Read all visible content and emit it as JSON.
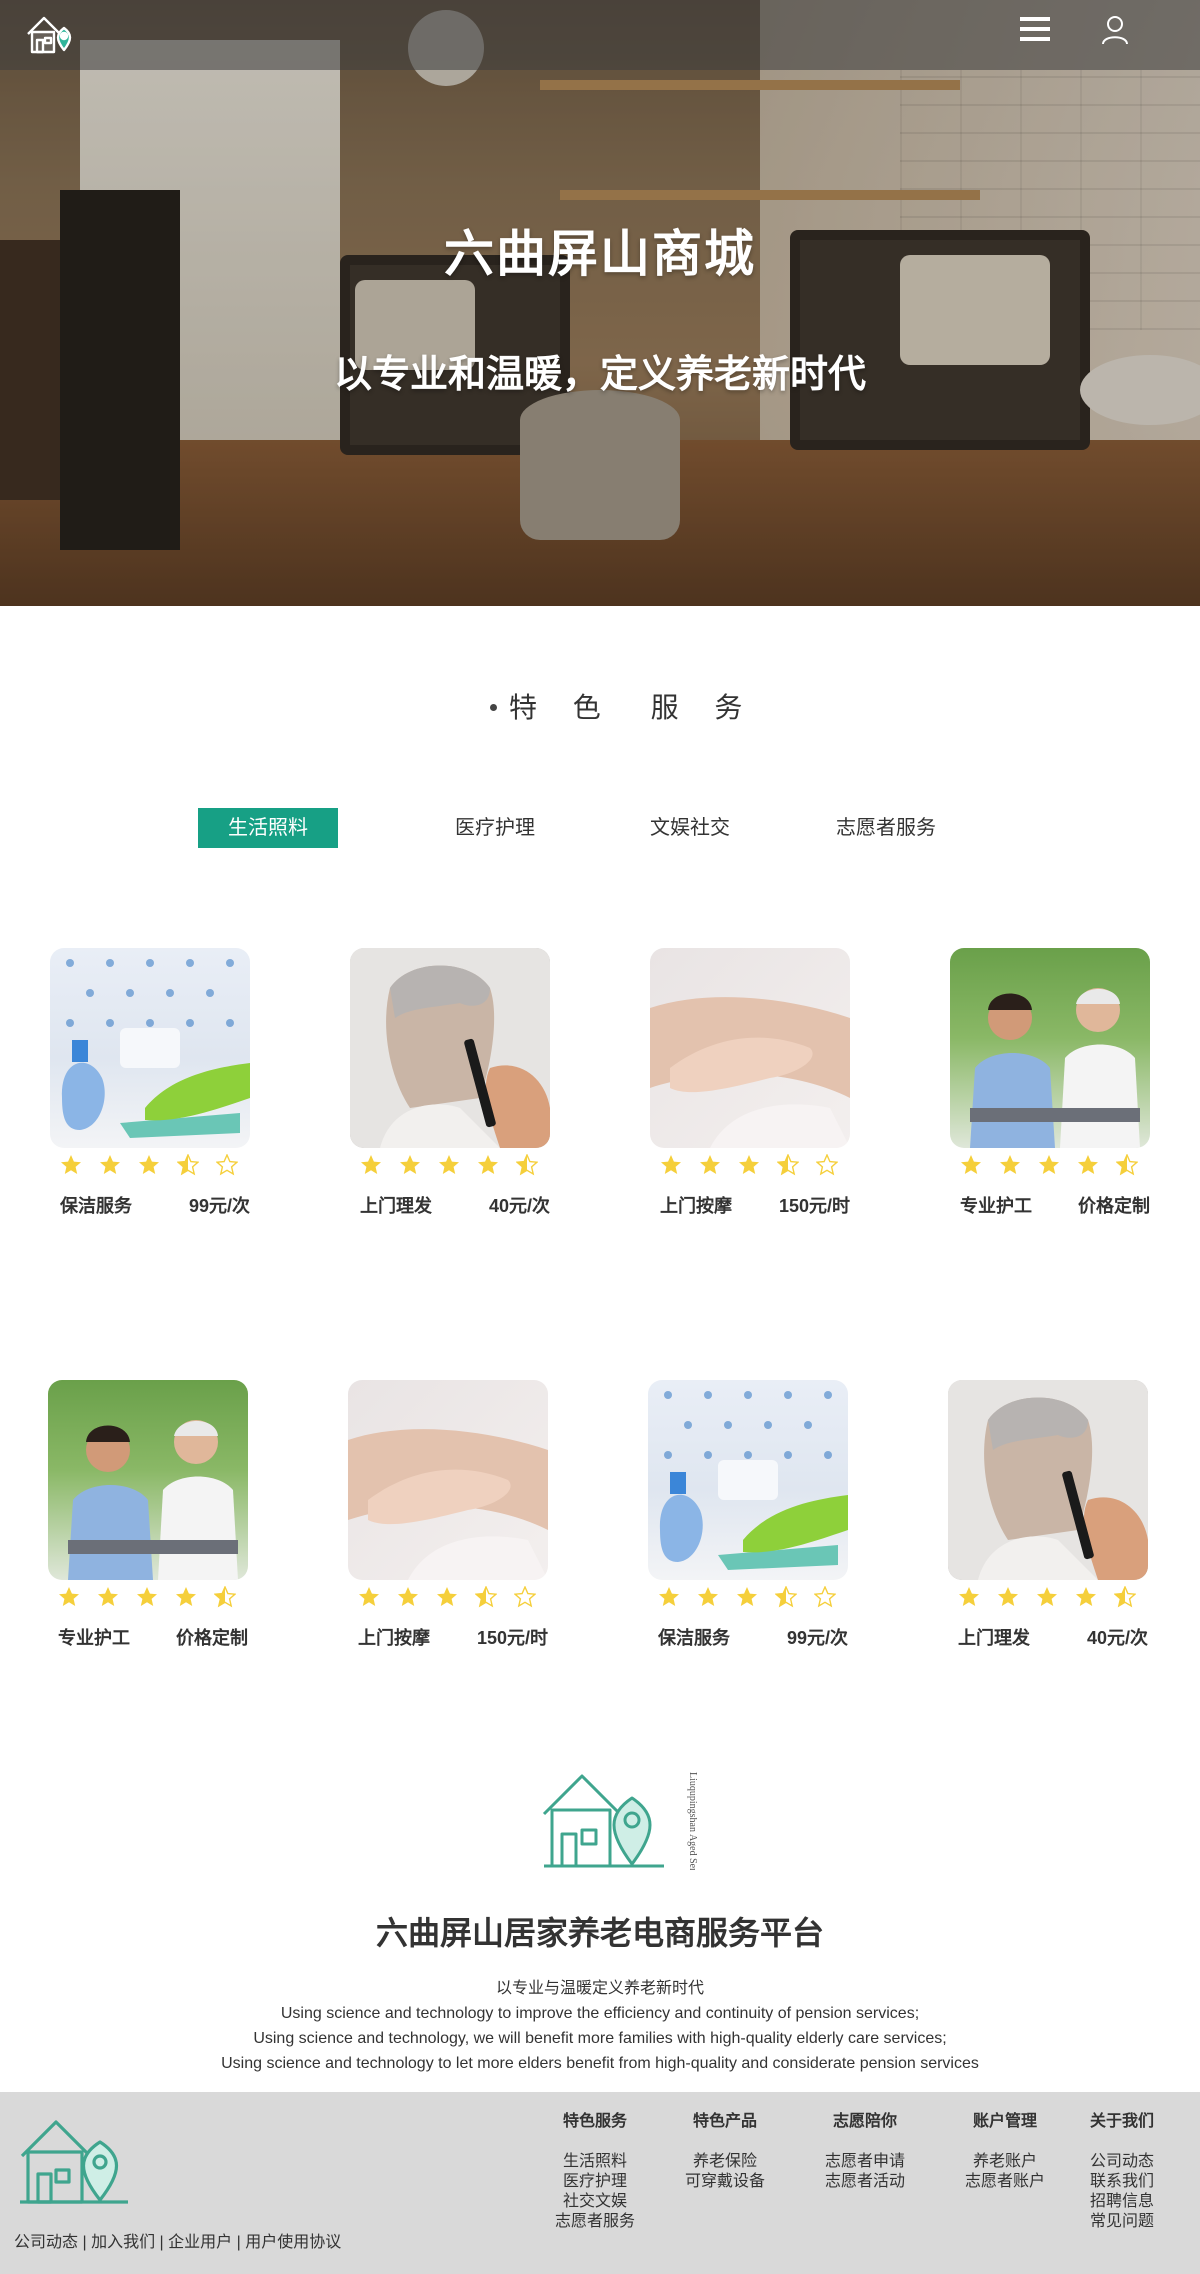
{
  "hero": {
    "title": "六曲屏山商城",
    "subtitle": "以专业和温暖，定义养老新时代"
  },
  "section": {
    "title_part1": "特 色",
    "title_part2": "服 务"
  },
  "tabs": [
    {
      "label": "生活照料",
      "active": true
    },
    {
      "label": "医疗护理",
      "active": false
    },
    {
      "label": "文娱社交",
      "active": false
    },
    {
      "label": "志愿者服务",
      "active": false
    }
  ],
  "cards": [
    {
      "name": "保洁服务",
      "price": "99元/次",
      "image": "cleaning-photo",
      "rating": 3.5
    },
    {
      "name": "上门理发",
      "price": "40元/次",
      "image": "haircut-photo",
      "rating": 4.5
    },
    {
      "name": "上门按摩",
      "price": "150元/时",
      "image": "massage-photo",
      "rating": 3.5
    },
    {
      "name": "专业护工",
      "price": "价格定制",
      "image": "caregiver-photo",
      "rating": 4.5
    },
    {
      "name": "专业护工",
      "price": "价格定制",
      "image": "caregiver-photo",
      "rating": 4.5
    },
    {
      "name": "上门按摩",
      "price": "150元/时",
      "image": "massage-photo",
      "rating": 3.5
    },
    {
      "name": "保洁服务",
      "price": "99元/次",
      "image": "cleaning-photo",
      "rating": 3.5
    },
    {
      "name": "上门理发",
      "price": "40元/次",
      "image": "haircut-photo",
      "rating": 4.5
    }
  ],
  "brand": {
    "logo_text": "Liuqupingshan Aged Service",
    "title": "六曲屏山居家养老电商服务平台",
    "lines": [
      "以专业与温暖定义养老新时代",
      "Using science and technology to improve the efficiency and continuity of pension services;",
      "Using science and technology, we will benefit more families with high-quality elderly care services;",
      "Using science and technology to let more elders benefit from high-quality and considerate pension services"
    ]
  },
  "footer": {
    "links": [
      "公司动态",
      "加入我们",
      "企业用户",
      "用户使用协议"
    ],
    "columns": [
      {
        "title": "特色服务",
        "items": [
          "生活照料",
          "医疗护理",
          "社交文娱",
          "志愿者服务"
        ]
      },
      {
        "title": "特色产品",
        "items": [
          "养老保险",
          "可穿戴设备"
        ]
      },
      {
        "title": "志愿陪你",
        "items": [
          "志愿者申请",
          "志愿者活动"
        ]
      },
      {
        "title": "账户管理",
        "items": [
          "养老账户",
          "志愿者账户"
        ]
      },
      {
        "title": "关于我们",
        "items": [
          "公司动态",
          "联系我们",
          "招聘信息",
          "常见问题"
        ]
      }
    ]
  },
  "colors": {
    "accent": "#17a085",
    "star": "#f5cf3b",
    "footer_bg": "#d9d9d9",
    "logo": "#3fa58e"
  },
  "icons": [
    "home-logo-icon",
    "menu-icon",
    "user-icon",
    "star-icon"
  ]
}
